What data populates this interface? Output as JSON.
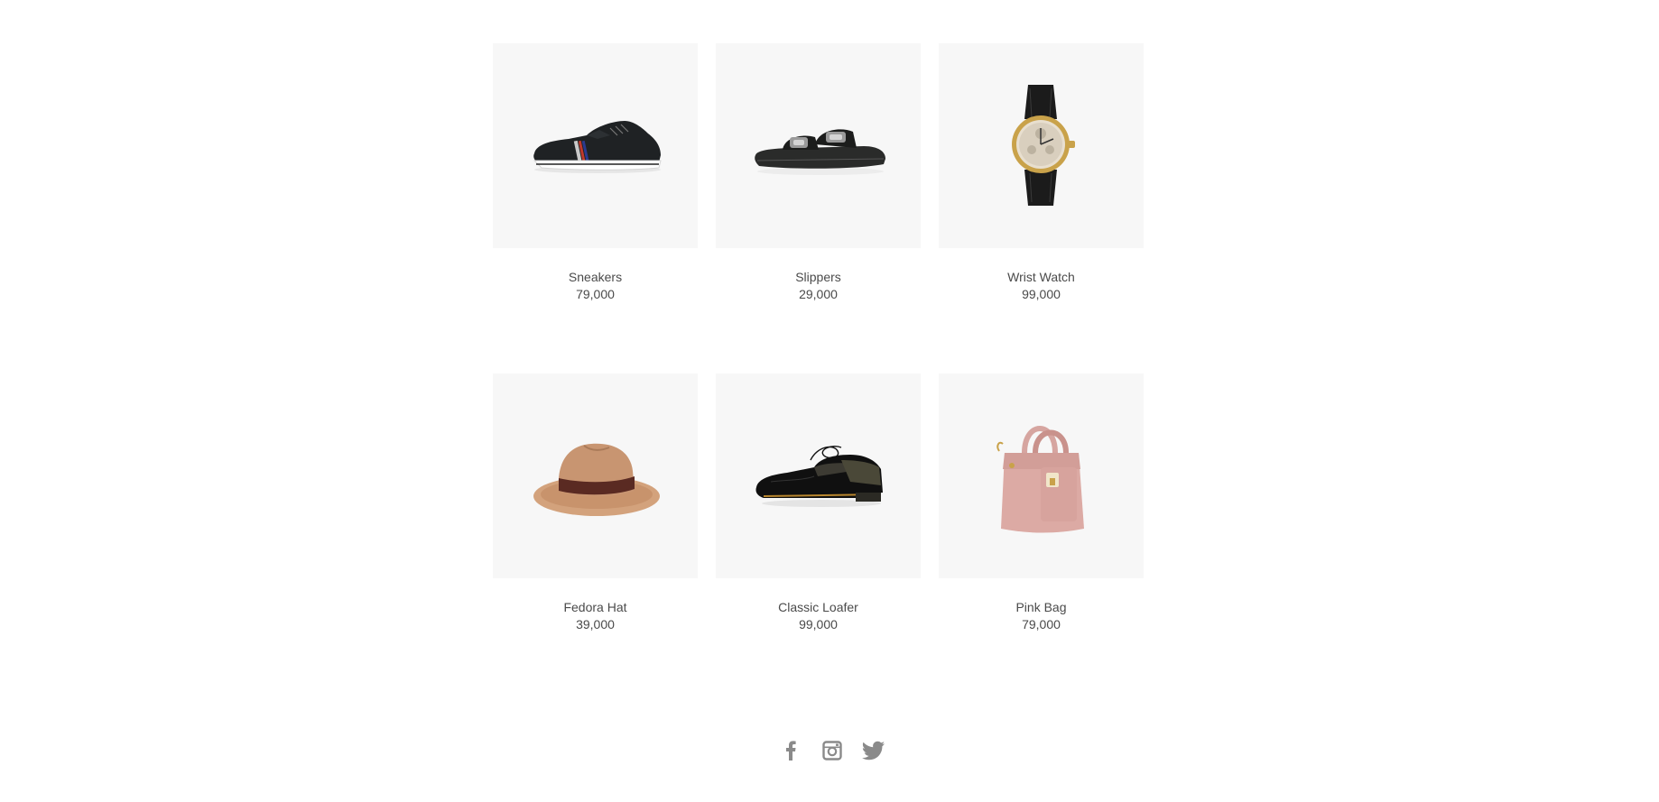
{
  "products": [
    {
      "name": "Sneakers",
      "price": "79,000",
      "image": "sneaker-image"
    },
    {
      "name": "Slippers",
      "price": "29,000",
      "image": "slipper-image"
    },
    {
      "name": "Wrist Watch",
      "price": "99,000",
      "image": "watch-image"
    },
    {
      "name": "Fedora Hat",
      "price": "39,000",
      "image": "hat-image"
    },
    {
      "name": "Classic Loafer",
      "price": "99,000",
      "image": "loafer-image"
    },
    {
      "name": "Pink Bag",
      "price": "79,000",
      "image": "bag-image"
    }
  ],
  "footer": {
    "social_icons": [
      "facebook-icon",
      "instagram-icon",
      "twitter-icon"
    ]
  },
  "colors": {
    "thumb_background": "#f7f7f7",
    "text": "#4a4a4a",
    "icon": "#8a8a8a"
  }
}
